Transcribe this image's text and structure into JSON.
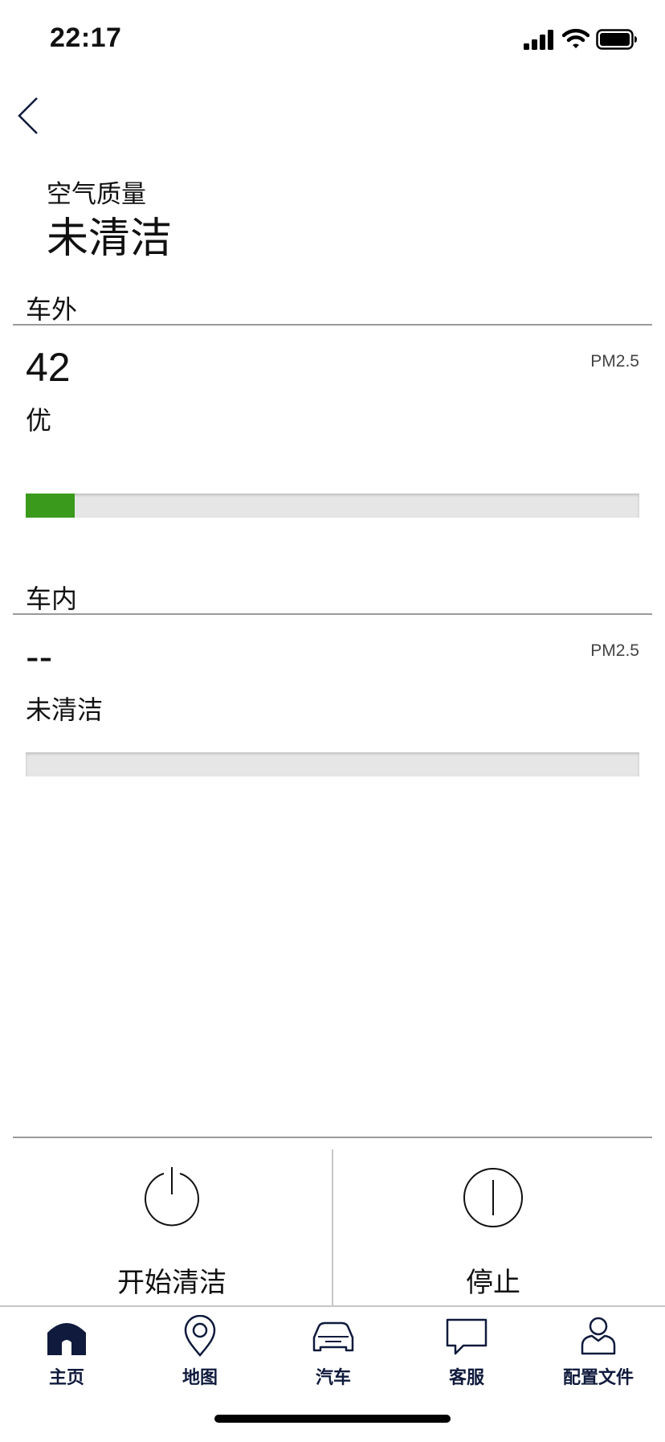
{
  "status_bar": {
    "time": "22:17"
  },
  "header": {
    "title_small": "空气质量",
    "title_big": "未清洁"
  },
  "outside": {
    "label": "车外",
    "value": "42",
    "level": "优",
    "unit": "PM2.5",
    "bar_fraction": 0.08,
    "bar_color": "#3a9a1b"
  },
  "inside": {
    "label": "车内",
    "value": "--",
    "level": "未清洁",
    "unit": "PM2.5",
    "bar_fraction": 0,
    "bar_color": "#3a9a1b"
  },
  "actions": {
    "start_label": "开始清洁",
    "stop_label": "停止"
  },
  "tabs": [
    {
      "label": "主页",
      "icon": "home-icon",
      "active": true
    },
    {
      "label": "地图",
      "icon": "map-pin-icon"
    },
    {
      "label": "汽车",
      "icon": "car-icon"
    },
    {
      "label": "客服",
      "icon": "chat-icon"
    },
    {
      "label": "配置文件",
      "icon": "profile-icon"
    }
  ],
  "colors": {
    "accent": "#0f1a3c",
    "good": "#3a9a1b"
  }
}
